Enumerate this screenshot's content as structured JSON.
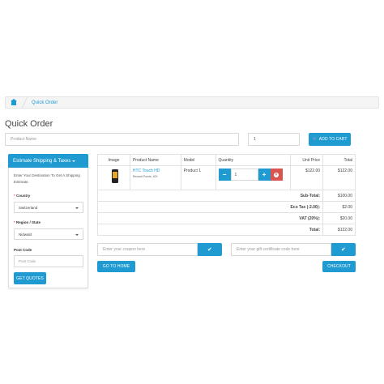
{
  "breadcrumb": {
    "home_icon": "home-icon",
    "current": "Quick Order"
  },
  "page_title": "Quick Order",
  "search": {
    "product_placeholder": "Product Name",
    "quantity_value": "1",
    "add_to_cart": "Add to Cart"
  },
  "shipping": {
    "title": "Estimate Shipping & Taxes",
    "intro": "Enter Your Destination To Get A Shipping Estimate.",
    "country_label": "Country",
    "country_value": "Switzerland",
    "region_label": "Region / State",
    "region_value": "Nidwald",
    "postcode_label": "Post Code",
    "postcode_placeholder": "Post Code",
    "get_quotes": "Get Quotes"
  },
  "cart": {
    "headers": [
      "Image",
      "Product Name",
      "Model",
      "Quantity",
      "Unit Price",
      "Total"
    ],
    "item": {
      "name": "HTC Touch HD",
      "reward": "Reward Points: 400",
      "model": "Product 1",
      "quantity": "1",
      "unit_price": "$122.00",
      "total": "$122.00"
    },
    "totals": [
      {
        "label": "Sub-Total:",
        "value": "$100.00"
      },
      {
        "label": "Eco Tax (-2.00):",
        "value": "$2.00"
      },
      {
        "label": "VAT (20%):",
        "value": "$20.00"
      },
      {
        "label": "Total:",
        "value": "$122.00"
      }
    ]
  },
  "coupon": {
    "placeholder": "Enter your coupon here"
  },
  "voucher": {
    "placeholder": "Enter your gift certificate code here"
  },
  "actions": {
    "home": "Go to Home",
    "checkout": "Checkout"
  },
  "colors": {
    "accent": "#1f9bd1",
    "danger": "#d9534f"
  }
}
